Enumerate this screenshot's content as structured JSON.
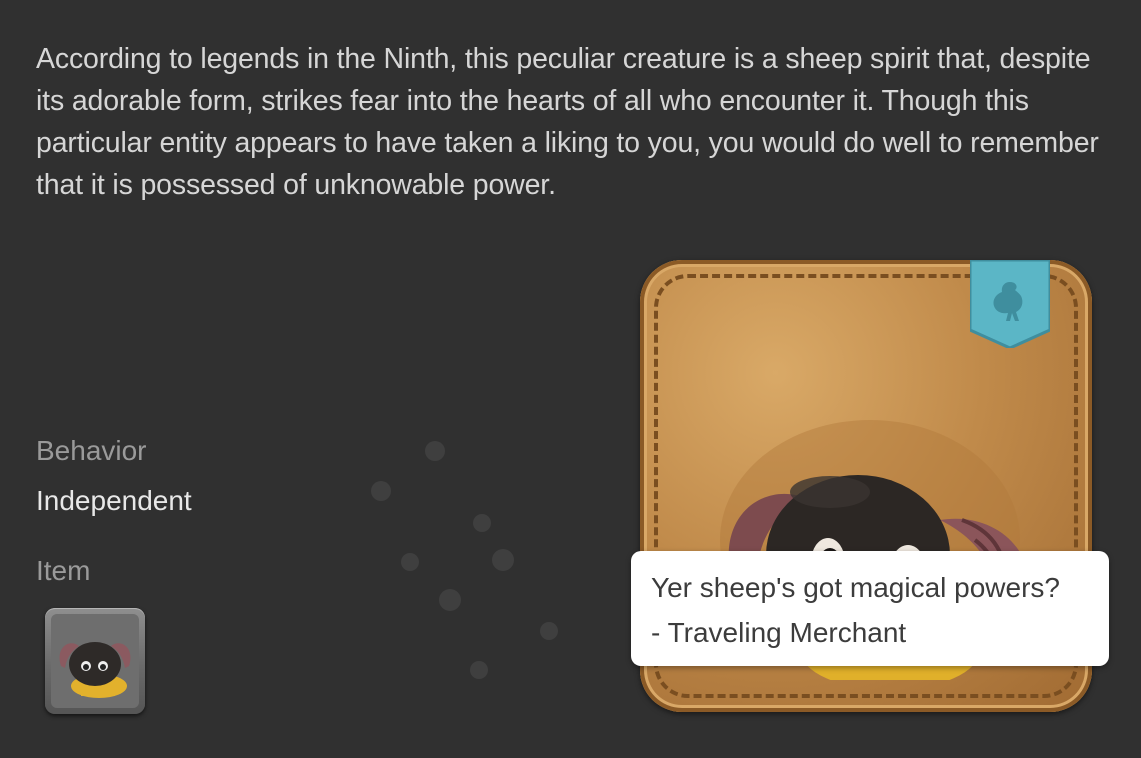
{
  "description": "According to legends in the Ninth, this peculiar creature is a sheep spirit that, despite its adorable form, strikes fear into the hearts of all who encounter it. Though this particular entity appears to have taken a liking to you, you would do well to remember that it is possessed of unknowable power.",
  "behavior": {
    "label": "Behavior",
    "value": "Independent"
  },
  "item": {
    "label": "Item",
    "icon": "sheep-minion-item-icon"
  },
  "card": {
    "image": "sheep-spirit-minion-portrait",
    "ribbon_icon": "chocobo-icon",
    "colors": {
      "leather": "#c08a4a",
      "ribbon": "#5bb6c6"
    }
  },
  "tooltip": {
    "quote": "Yer sheep's got magical powers?",
    "author": "- Traveling Merchant"
  },
  "colors": {
    "background": "#303030",
    "text": "#d6d6d6",
    "muted": "#9a9a9a"
  }
}
